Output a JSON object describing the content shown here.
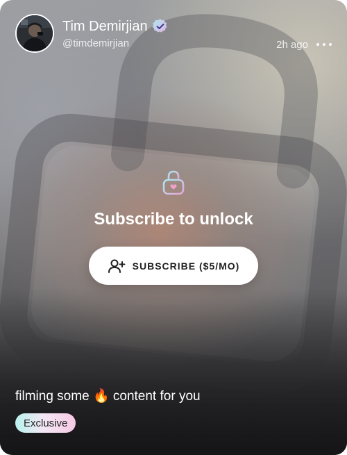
{
  "post": {
    "author": {
      "name": "Tim Demirjian",
      "handle": "@timdemirjian",
      "verified_icon": "verified-badge-icon",
      "avatar_icon": "avatar-photo"
    },
    "time": "2h ago",
    "more_icon": "more-dots-icon",
    "locked": {
      "icon": "unlock-heart-icon",
      "title": "Subscribe to unlock",
      "button_label": "SUBSCRIBE ($5/MO)",
      "button_icon": "add-user-icon"
    },
    "caption_before": "filming some",
    "caption_emoji": "🔥",
    "caption_after": "content for you",
    "badge": "Exclusive"
  },
  "colors": {
    "badge_gradient": [
      "#b9f2ee",
      "#f6c9e3"
    ],
    "verified_gradient": [
      "#a9e8f0",
      "#e6b4e6"
    ],
    "button_bg": "#ffffff",
    "text": "#ffffff"
  }
}
